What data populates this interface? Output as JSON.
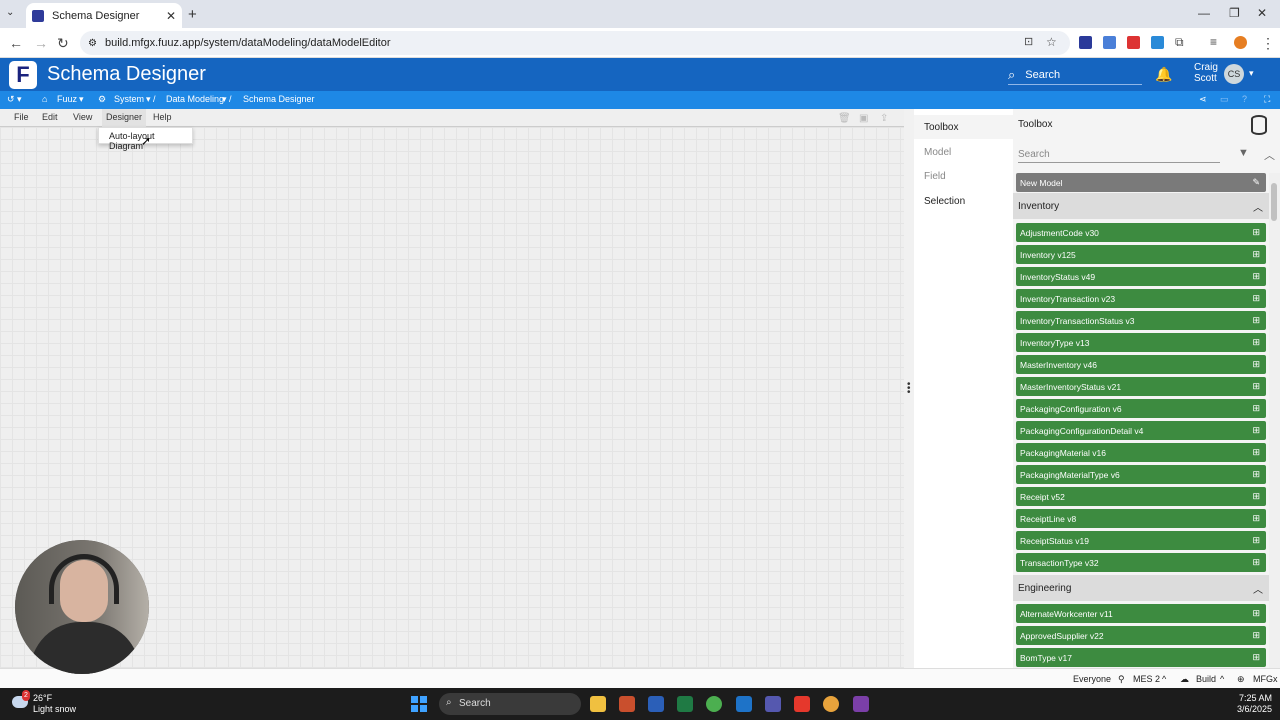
{
  "browser": {
    "tab_title": "Schema Designer",
    "tab_close": "✕",
    "new_tab": "+",
    "url": "build.mfgx.fuuz.app/system/dataModeling/dataModelEditor"
  },
  "app": {
    "title": "Schema Designer",
    "logo": "F",
    "search_label": "Search",
    "user_first": "Craig",
    "user_last": "Scott",
    "user_initials": "CS"
  },
  "breadcrumb": {
    "home": "Fuuz",
    "system": "System",
    "data_modeling": "Data Modeling",
    "current": "Schema Designer"
  },
  "menu": {
    "file": "File",
    "edit": "Edit",
    "view": "View",
    "designer": "Designer",
    "help": "Help",
    "dropdown_item": "Auto-layout Diagram"
  },
  "side_tabs": [
    "Toolbox",
    "Model",
    "Field",
    "Selection"
  ],
  "toolbox": {
    "title": "Toolbox",
    "search_placeholder": "Search",
    "new_model": "New Model",
    "groups": [
      {
        "name": "Inventory",
        "items": [
          "AdjustmentCode v30",
          "Inventory v125",
          "InventoryStatus v49",
          "InventoryTransaction v23",
          "InventoryTransactionStatus v3",
          "InventoryType v13",
          "MasterInventory v46",
          "MasterInventoryStatus v21",
          "PackagingConfiguration v6",
          "PackagingConfigurationDetail v4",
          "PackagingMaterial v16",
          "PackagingMaterialType v6",
          "Receipt v52",
          "ReceiptLine v8",
          "ReceiptStatus v19",
          "TransactionType v32"
        ]
      },
      {
        "name": "Engineering",
        "items": [
          "AlternateWorkcenter v11",
          "ApprovedSupplier v22",
          "BomType v17"
        ]
      }
    ]
  },
  "statusbar": {
    "everyone": "Everyone",
    "site": "MES 2",
    "env": "Build",
    "tenant": "MFGx"
  },
  "taskbar": {
    "temp": "26°F",
    "weather": "Light snow",
    "search": "Search",
    "time": "7:25 AM",
    "date": "3/6/2025",
    "weather_badge": "2"
  }
}
